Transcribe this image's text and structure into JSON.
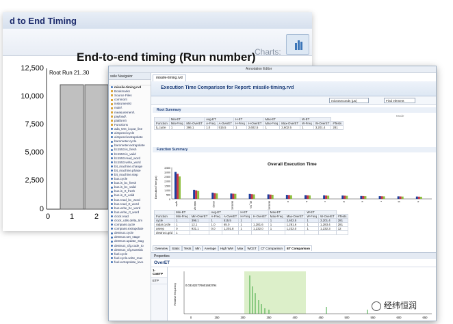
{
  "back_window": {
    "title": "d to End Timing",
    "charts_label": "Charts:",
    "chart_title": "End-to-end timing (Run number)",
    "y_ticks": [
      "12,500",
      "10,000",
      "7,500",
      "5,000",
      "2,500",
      "0"
    ],
    "x_ticks": [
      "0",
      "1",
      "2"
    ],
    "bar_labels": [
      "Root",
      "Run 21..30"
    ]
  },
  "front_window": {
    "toolbar_label": "Annotation Editor",
    "nav": {
      "header": "ssile Navigator",
      "items": [
        {
          "label": "missile-timing.rvd",
          "kind": "file"
        },
        {
          "label": "Bookmarks",
          "kind": "fold"
        },
        {
          "label": "Source Files",
          "kind": "fold"
        },
        {
          "label": "common\\",
          "kind": "fold"
        },
        {
          "label": "instruments\\",
          "kind": "fold"
        },
        {
          "label": "main\\",
          "kind": "fold"
        },
        {
          "label": "measurement\\",
          "kind": "fold"
        },
        {
          "label": "payload\\",
          "kind": "fold"
        },
        {
          "label": "platform\\",
          "kind": "fold"
        },
        {
          "label": "Functions",
          "kind": "fold"
        },
        {
          "label": "ada_test_io.put_line",
          "kind": "fn"
        },
        {
          "label": "airspeed.cycle",
          "kind": "fn"
        },
        {
          "label": "airspeed.extrapolate",
          "kind": "fn"
        },
        {
          "label": "barometer.cycle",
          "kind": "fn"
        },
        {
          "label": "barometer.extrapolate",
          "kind": "fn"
        },
        {
          "label": "bc1553.is_fresh",
          "kind": "fn"
        },
        {
          "label": "bc1553.is_valid",
          "kind": "fn"
        },
        {
          "label": "bc1553.read_word",
          "kind": "fn"
        },
        {
          "label": "bc1553.write_word",
          "kind": "fn"
        },
        {
          "label": "bit_machine.change",
          "kind": "fn"
        },
        {
          "label": "bit_machine.phase",
          "kind": "fn"
        },
        {
          "label": "bit_machine.step",
          "kind": "fn"
        },
        {
          "label": "bus.cycle",
          "kind": "fn"
        },
        {
          "label": "bus.is_bc_fresh",
          "kind": "fn"
        },
        {
          "label": "bus.is_bc_valid",
          "kind": "fn"
        },
        {
          "label": "bus.is_rt_fresh",
          "kind": "fn"
        },
        {
          "label": "bus.is_rt_valid",
          "kind": "fn"
        },
        {
          "label": "bus.read_bc_word",
          "kind": "fn"
        },
        {
          "label": "bus.read_rt_word",
          "kind": "fn"
        },
        {
          "label": "bus.write_bc_word",
          "kind": "fn"
        },
        {
          "label": "bus.write_rt_word",
          "kind": "fn"
        },
        {
          "label": "clock.read",
          "kind": "fn"
        },
        {
          "label": "clock_utils.delta_tim",
          "kind": "fn"
        },
        {
          "label": "compass.cycle",
          "kind": "fn"
        },
        {
          "label": "compass.extrapolate",
          "kind": "fn"
        },
        {
          "label": "destruct.cycle",
          "kind": "fn"
        },
        {
          "label": "destruct.set_stage",
          "kind": "fn"
        },
        {
          "label": "destruct.update_stag",
          "kind": "fn"
        },
        {
          "label": "destruct_cfg.code_to",
          "kind": "fn"
        },
        {
          "label": "destruct_cfg.transitic",
          "kind": "fn"
        },
        {
          "label": "fuel.cycle",
          "kind": "fn"
        },
        {
          "label": "fuel.cycle.write_mac",
          "kind": "fn"
        },
        {
          "label": "fuel.extrapolate_leve",
          "kind": "fn"
        }
      ]
    },
    "tab_label": "missile-timing.rvd",
    "report_title": "Execution Time Comparison for Report: missile-timing.rvd",
    "units_select": "microseconds (µs)",
    "find_label": "Find element",
    "root_summary_label": "Root Summary",
    "mode_label": "Mode",
    "function_summary_label": "Function Summary",
    "root_table": {
      "group_headers": [
        "Min-ET",
        "Avg-ET",
        "H-ET",
        "Max-ET",
        "W-ET"
      ],
      "headers": [
        "Function",
        "Min-Freq",
        "Min-OverET",
        "A-Freq",
        "A-OverET",
        "H-Freq",
        "H-OverET",
        "Max-Freq",
        "Max-OverET",
        "W-Freq",
        "W-OverET",
        "#Tests"
      ],
      "rows": [
        [
          "lj_cycle",
          "1",
          "396.1",
          "1.0",
          "515.5",
          "1",
          "2,602.5",
          "1",
          "2,602.5",
          "1",
          "3,201.4",
          "281"
        ]
      ]
    },
    "chart": {
      "title": "Overall Execution Time",
      "ylabel": "Execution Time (µs)",
      "y_ticks": [
        "3,500",
        "3,000",
        "2,500",
        "2,000",
        "1,500",
        "1,000",
        "500",
        "0"
      ]
    },
    "chart_data": {
      "type": "bar",
      "title": "Overall Execution Time",
      "ylabel": "Execution Time (µs)",
      "ylim": [
        0,
        3500
      ],
      "categories": [
        "cycle",
        "radar.cycle",
        "aseep",
        "destruct.grid",
        "db_hm",
        "destruct_grid",
        "a",
        "b",
        "c",
        "d",
        "e",
        "f",
        "g",
        "h"
      ],
      "series": [
        {
          "values": [
            3000,
            1000,
            700,
            600,
            550,
            500,
            450,
            420,
            400,
            380,
            320,
            300,
            280,
            260
          ]
        },
        {
          "values": [
            2800,
            950,
            650,
            580,
            520,
            480,
            430,
            400,
            380,
            360,
            310,
            290,
            270,
            250
          ]
        },
        {
          "values": [
            2500,
            900,
            620,
            560,
            500,
            460,
            410,
            390,
            360,
            340,
            300,
            280,
            260,
            240
          ]
        }
      ],
      "series_colors": [
        "#1f3f9e",
        "#c8364a",
        "#8fbf3f",
        "#7b5fb8",
        "#3aa6c9",
        "#e59a2f"
      ]
    },
    "function_table": {
      "group_headers": [
        "Min-ET",
        "Avg-ET",
        "H-ET",
        "Max-ET",
        "W-ET"
      ],
      "headers": [
        "Function",
        "Min-Freq",
        "Min-OverET",
        "A-Freq",
        "A-OverET",
        "H-Freq",
        "H-OverET",
        "Max-Freq",
        "Max-OverET",
        "W-Freq",
        "W-OverET",
        "#Tests"
      ],
      "rows": [
        [
          "cycle",
          "1",
          "396.1",
          "1",
          "515.5",
          "1",
          "2,602.5",
          "1",
          "2,602.5",
          "1",
          "3,201.4",
          "281"
        ],
        [
          "radar.cycle",
          "1",
          "12.1",
          "1.0",
          "65.0",
          "1",
          "1,281.6",
          "1",
          "1,281.6",
          "1",
          "1,283.4",
          "281"
        ],
        [
          "aseep",
          "0",
          "931.1",
          "0.0",
          "1,201.8",
          "1",
          "1,232.0",
          "1",
          "1,232.0",
          "1",
          "1,232.3",
          "12"
        ],
        [
          "destruct.grid",
          "1",
          "",
          "",
          "",
          "",
          "",
          "",
          "",
          "",
          "",
          ""
        ]
      ]
    },
    "bottom_tabs": [
      "Overview",
      "Static",
      "Tests",
      "Min",
      "Average",
      "High WM",
      "Max",
      "WCET",
      "CT Comparison",
      "ET Comparison"
    ],
    "properties_label": "Properties",
    "overet_label": "OverET",
    "side_tabs": [
      "1-CoETP",
      "ETP"
    ],
    "freq_chart": {
      "annotation": "0.031622776601683794",
      "ylabel": "Relative frequency",
      "x_ticks": [
        "0",
        "250",
        "300",
        "350",
        "400",
        "450",
        "500",
        "550",
        "600",
        "650"
      ]
    }
  },
  "watermark": "经纬恒润"
}
